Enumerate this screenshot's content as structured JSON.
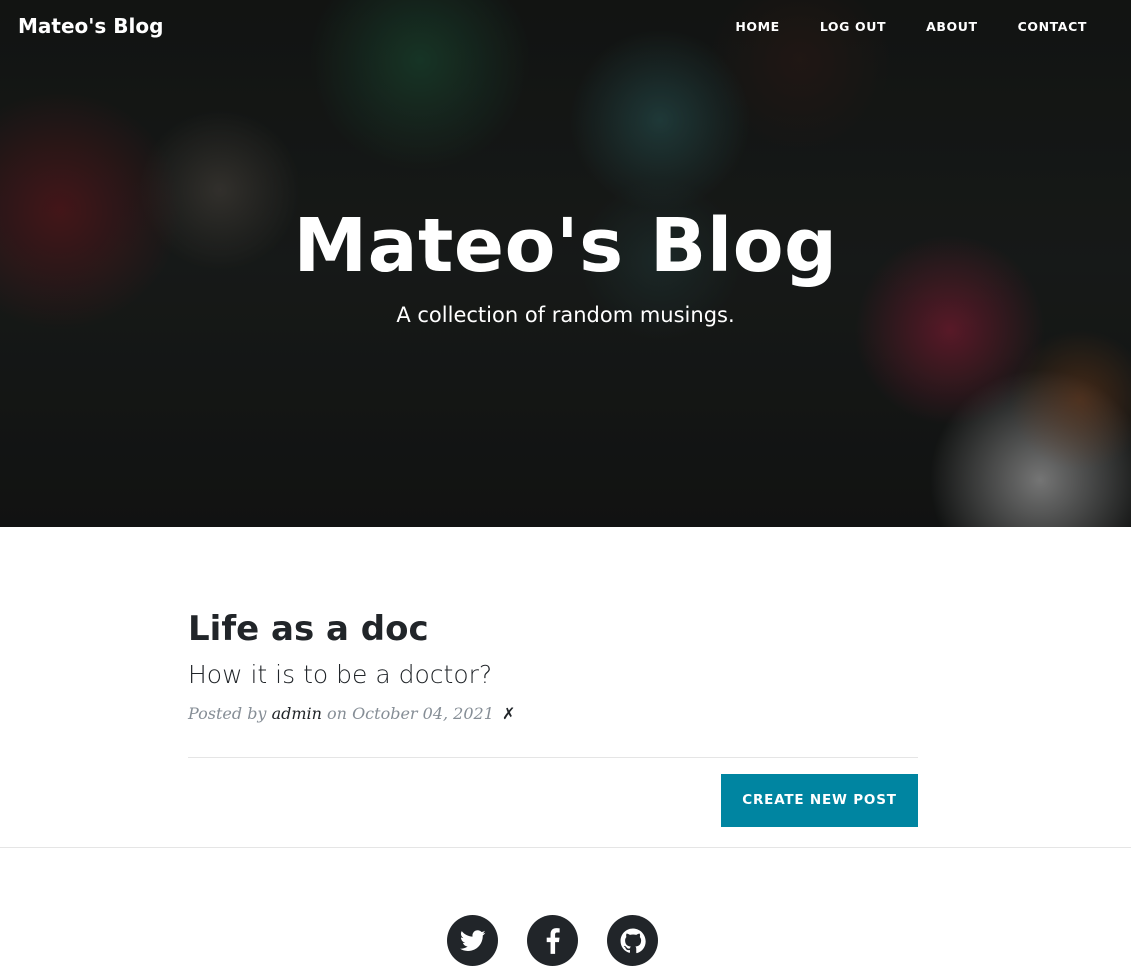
{
  "navbar": {
    "brand": "Mateo's Blog",
    "links": [
      {
        "label": "HOME"
      },
      {
        "label": "LOG OUT"
      },
      {
        "label": "ABOUT"
      },
      {
        "label": "CONTACT"
      }
    ]
  },
  "hero": {
    "title": "Mateo's Blog",
    "subtitle": "A collection of random musings."
  },
  "posts": [
    {
      "title": "Life as a doc",
      "subtitle": "How it is to be a doctor?",
      "meta_prefix": "Posted by",
      "author": "admin",
      "meta_middle": "on",
      "date": "October 04, 2021",
      "delete_symbol": "✗"
    }
  ],
  "actions": {
    "create_label": "CREATE NEW POST"
  },
  "footer": {
    "social": [
      {
        "icon": "twitter-icon"
      },
      {
        "icon": "facebook-icon"
      },
      {
        "icon": "github-icon"
      }
    ]
  },
  "colors": {
    "accent": "#0085a1",
    "text_dark": "#212529",
    "meta_gray": "#868e96"
  }
}
